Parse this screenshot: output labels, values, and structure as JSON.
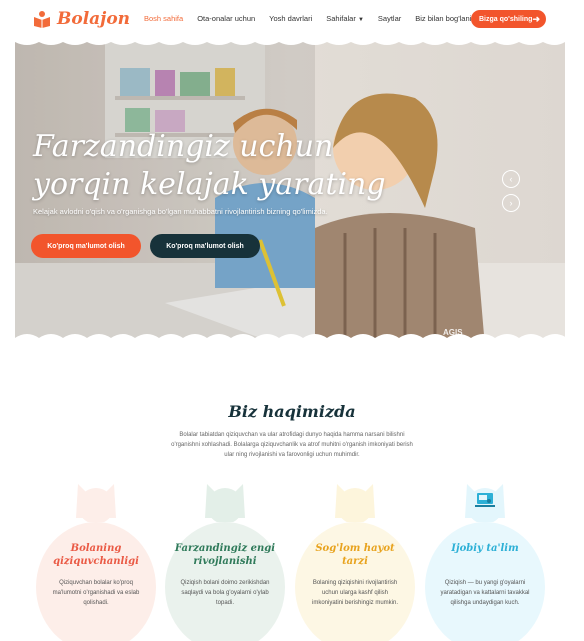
{
  "brand": {
    "name": "Bolajon",
    "accent": "#f26b3a",
    "dark": "#17323a"
  },
  "nav": {
    "items": [
      {
        "label": "Bosh sahifa",
        "active": true
      },
      {
        "label": "Ota-onalar uchun"
      },
      {
        "label": "Yosh davrlari"
      },
      {
        "label": "Sahifalar",
        "icon": "chevron-down-icon"
      },
      {
        "label": "Saytlar"
      },
      {
        "label": "Biz bilan bog'lanish"
      }
    ],
    "cta": "Bizga qo'shiling",
    "cta_icon": "arrow-right-icon"
  },
  "hero": {
    "title": "Farzandingiz uchun yorqin kelajak yarating",
    "subtitle": "Kelajak avlodni o'qish va o'rganishga bo'lgan muhabbatni rivojlantirish bizning qo'limizda.",
    "btn_primary": "Ko'proq ma'lumot olish",
    "btn_secondary": "Ko'proq ma'lumot olish",
    "watermark": "AGIS"
  },
  "about": {
    "title": "Biz haqimizda",
    "text": "Bolalar tabiatdan qiziquvchan va ular atrofidagi dunyo haqida hamma narsani bilishni o'rganishni xohlashadi. Bolalarga qiziquvchanlik va atrof muhitni o'rganish imkoniyati berish ular ning rivojlanishi va farovonligi uchun muhimdir.",
    "cards": [
      {
        "title": "Bolaning qiziquvchanligi",
        "text": "Qiziquvchan bolalar ko'proq ma'lumotni o'rganishadi va eslab qolishadi.",
        "color": "#ea5a45",
        "bg": "#fdeee9"
      },
      {
        "title": "Farzandingiz engi rivojlanishi",
        "text": "Qiziqish bolani doimo zerikishdan saqlaydi va bola g'oyalarni o'ylab topadi.",
        "color": "#2f7a5a",
        "bg": "#eaf2ed"
      },
      {
        "title": "Sog'lom hayot tarzi",
        "text": "Bolaning qiziqishini rivojlantirish uchun ularga kashf qilish imkoniyatini berishingiz mumkin.",
        "color": "#e8a31e",
        "bg": "#fdf7e4"
      },
      {
        "title": "Ijobiy ta'lim",
        "text": "Qiziqish — bu yangi g'oyalarni yaratadigan va kattalarni tavakkal qilishga undaydigan kuch.",
        "color": "#2db0d6",
        "bg": "#e8f8fd",
        "icon": "presentation-icon"
      }
    ]
  }
}
